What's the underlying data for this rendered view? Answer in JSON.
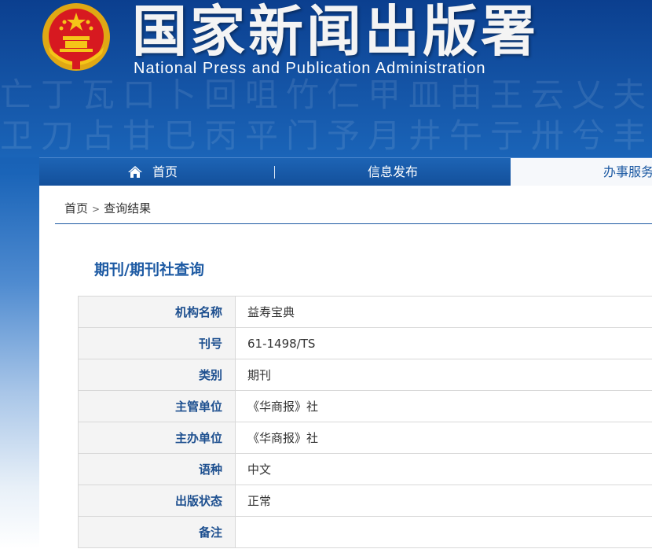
{
  "header": {
    "title": "国家新闻出版署",
    "subtitle": "National Press and Publication Administration"
  },
  "nav": {
    "items": [
      {
        "label": "首页",
        "icon": "home-icon"
      },
      {
        "label": "信息发布"
      },
      {
        "label": "办事服务"
      }
    ]
  },
  "breadcrumb": {
    "home": "首页",
    "separator": ">",
    "current": "查询结果"
  },
  "main": {
    "heading": "期刊/期刊社查询",
    "rows": [
      {
        "label": "机构名称",
        "value": "益寿宝典"
      },
      {
        "label": "刊号",
        "value": "61-1498/TS"
      },
      {
        "label": "类别",
        "value": "期刊"
      },
      {
        "label": "主管单位",
        "value": "《华商报》社"
      },
      {
        "label": "主办单位",
        "value": "《华商报》社"
      },
      {
        "label": "语种",
        "value": "中文"
      },
      {
        "label": "出版状态",
        "value": "正常"
      },
      {
        "label": "备注",
        "value": ""
      }
    ]
  },
  "colors": {
    "brand_blue": "#1d5aa3",
    "header_blue": "#0b3f8f",
    "emblem_red": "#d71920",
    "emblem_gold": "#f5c518"
  }
}
